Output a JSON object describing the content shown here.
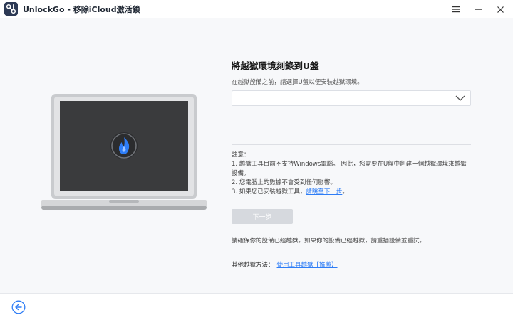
{
  "app": {
    "name": "UnlockGo",
    "separator": " - ",
    "module": "移除iCloud激活鎖"
  },
  "step": {
    "title": "將越獄環境刻錄到U盤",
    "description": "在越獄設備之前，請選擇U盤以便安裝越獄環境。",
    "drive_select_value": ""
  },
  "notes": {
    "heading": "註意：",
    "line1": "1. 越獄工具目前不支持Windows電腦。 因此，您需要在U盤中創建一個越獄環境來越獄",
    "line1_cont": "設備。",
    "line2": "2. 您電腦上的數據不會受到任何影響。",
    "line3_prefix": "3. 如果您已安裝越獄工具，",
    "line3_link": "請跳至下一步",
    "line3_suffix": "。"
  },
  "buttons": {
    "next": "下一步"
  },
  "hint": "請確保你的設備已經越獄。如果你的設備已經越獄，請重插設備並重試。",
  "other_methods": {
    "label": "其他越獄方法：",
    "link": "使用工具越獄【推薦】"
  },
  "colors": {
    "accent": "#2e7df6",
    "disabled_button": "#d6d9de",
    "logo": "#2d3a55"
  }
}
